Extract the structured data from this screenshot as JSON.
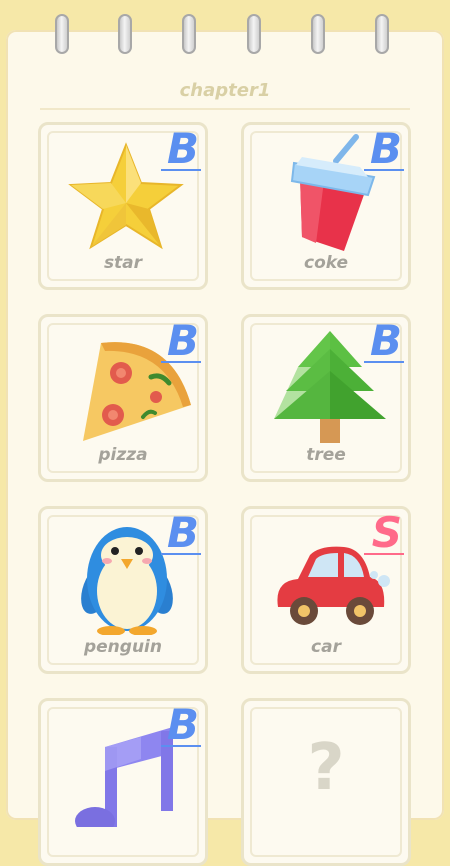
{
  "chapter_title": "chapter1",
  "colors": {
    "grade_b": "#5b8ff0",
    "grade_s": "#ff6a8a",
    "background": "#f6e8a8"
  },
  "cards": [
    {
      "label": "star",
      "grade": "B",
      "icon": "star-icon"
    },
    {
      "label": "coke",
      "grade": "B",
      "icon": "coke-cup-icon"
    },
    {
      "label": "pizza",
      "grade": "B",
      "icon": "pizza-slice-icon"
    },
    {
      "label": "tree",
      "grade": "B",
      "icon": "pine-tree-icon"
    },
    {
      "label": "penguin",
      "grade": "B",
      "icon": "penguin-icon"
    },
    {
      "label": "car",
      "grade": "S",
      "icon": "car-icon"
    },
    {
      "label": "",
      "grade": "B",
      "icon": "music-note-icon"
    },
    {
      "label": "",
      "grade": "",
      "icon": "question-mark-icon",
      "locked_symbol": "?"
    }
  ]
}
